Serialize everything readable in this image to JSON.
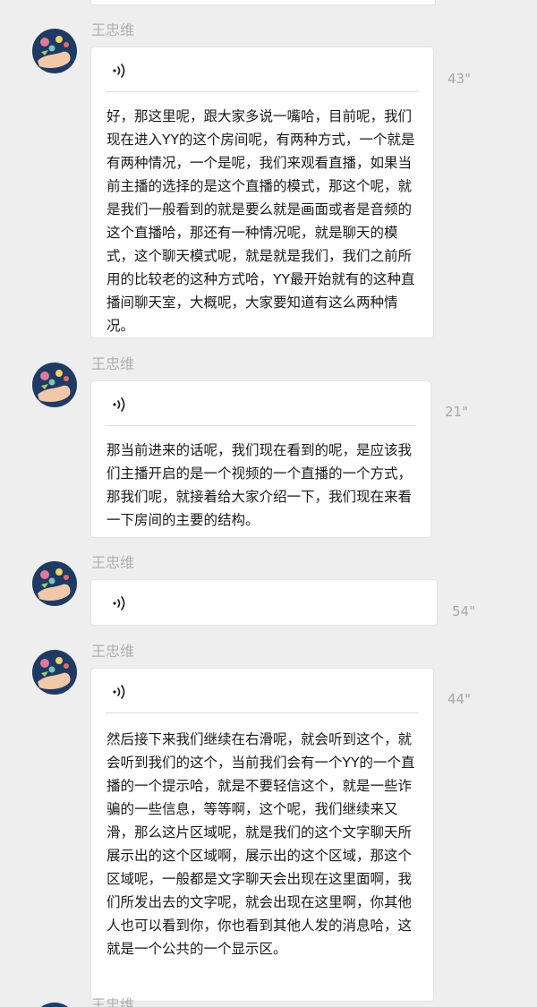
{
  "colors": {
    "background": "#eeeeee",
    "bubble": "#ffffff",
    "sender_name": "#b0b0b0",
    "duration": "#a8a8a8",
    "text": "#1a1a1a",
    "avatar_bg": "#1f3a63"
  },
  "messages": [
    {
      "sender": "王忠维",
      "voice_icon": "voice-message-icon",
      "duration": "43\"",
      "transcript": "好，那这里呢，跟大家多说一嘴哈，目前呢，我们现在进入YY的这个房间呢，有两种方式，一个就是有两种情况，一个是呢，我们来观看直播，如果当前主播的选择的是这个直播的模式，那这个呢，就是我们一般看到的就是要么就是画面或者是音频的这个直播哈，那还有一种情况呢，就是聊天的模式，这个聊天模式呢，就是就是我们，我们之前所用的比较老的这种方式哈，YY最开始就有的这种直播间聊天室，大概呢，大家要知道有这么两种情况。"
    },
    {
      "sender": "王忠维",
      "voice_icon": "voice-message-icon",
      "duration": "21\"",
      "transcript": "那当前进来的话呢，我们现在看到的呢，是应该我们主播开启的是一个视频的一个直播的一个方式，那我们呢，就接着给大家介绍一下，我们现在来看一下房间的主要的结构。"
    },
    {
      "sender": "王忠维",
      "voice_icon": "voice-message-icon",
      "duration": "54\"",
      "transcript": ""
    },
    {
      "sender": "王忠维",
      "voice_icon": "voice-message-icon",
      "duration": "44\"",
      "transcript": "然后接下来我们继续在右滑呢，就会听到这个，就会听到我们的这个，当前我们会有一个YY的一个直播的一个提示哈，就是不要轻信这个，就是一些诈骗的一些信息，等等啊，这个呢，我们继续来又滑，那么这片区域呢，就是我们的这个文字聊天所展示出的这个区域啊，展示出的这个区域，那这个区域呢，一般都是文字聊天会出现在这里面啊，我们所发出去的文字呢，就会出现在这里啊，你其他人也可以看到你，你也看到其他人发的消息哈，这就是一个公共的一个显示区。"
    },
    {
      "sender": "王忠维"
    }
  ]
}
